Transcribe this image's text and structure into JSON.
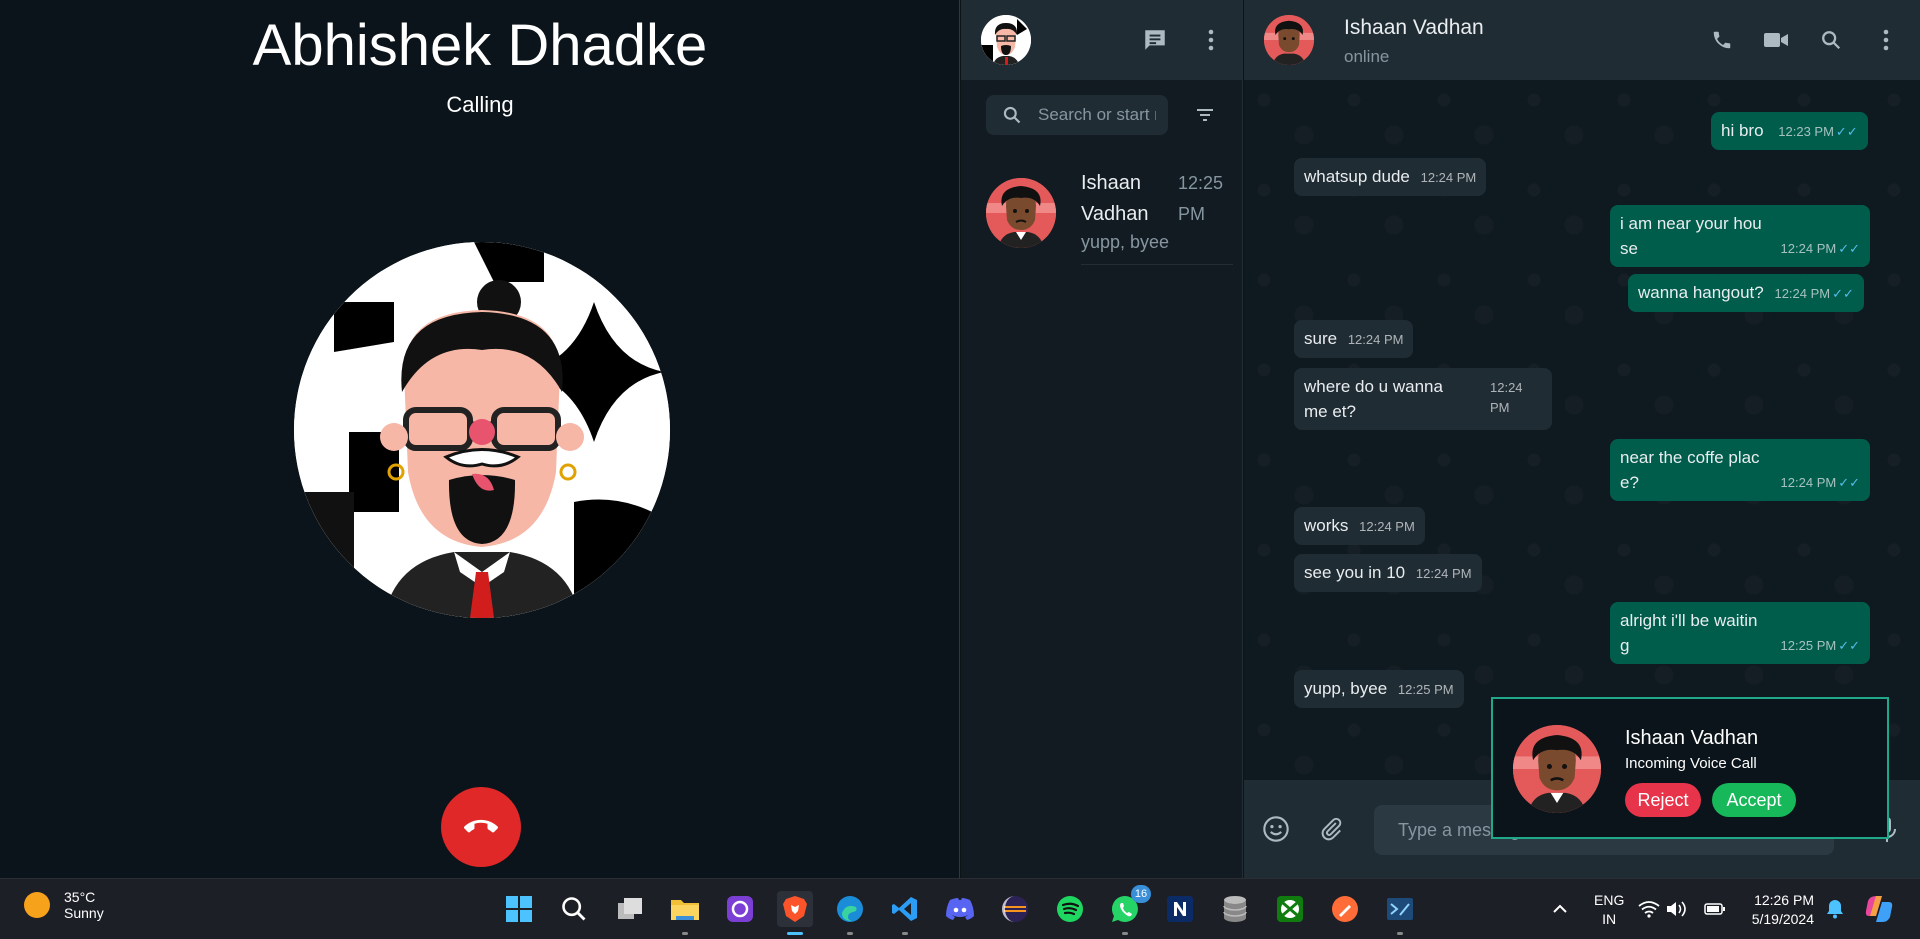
{
  "call": {
    "caller_name": "Abhishek Dhadke",
    "status": "Calling"
  },
  "chat_list": {
    "search_placeholder": "Search or start new chat",
    "items": [
      {
        "name": "Ishaan Vadhan",
        "time": "12:25 PM",
        "preview": "yupp, byee"
      }
    ]
  },
  "conversation": {
    "contact_name": "Ishaan Vadhan",
    "contact_status": "online",
    "messages": [
      {
        "dir": "out",
        "text": "hi bro",
        "time": "12:23 PM"
      },
      {
        "dir": "in",
        "text": "whatsup dude",
        "time": "12:24 PM"
      },
      {
        "dir": "out",
        "text": "i am near your hou se",
        "time": "12:24 PM"
      },
      {
        "dir": "out",
        "text": "wanna hangout?",
        "time": "12:24 PM"
      },
      {
        "dir": "in",
        "text": "sure",
        "time": "12:24 PM"
      },
      {
        "dir": "in",
        "text": "where do u wanna me et?",
        "time": "12:24 PM"
      },
      {
        "dir": "out",
        "text": "near the coffe plac e?",
        "time": "12:24 PM"
      },
      {
        "dir": "in",
        "text": "works",
        "time": "12:24 PM"
      },
      {
        "dir": "in",
        "text": "see you in 10",
        "time": "12:24 PM"
      },
      {
        "dir": "out",
        "text": "alright i'll be waitin g",
        "time": "12:25 PM"
      },
      {
        "dir": "in",
        "text": "yupp, byee",
        "time": "12:25 PM"
      }
    ],
    "input_placeholder": "Type a message"
  },
  "incoming_call": {
    "name": "Ishaan Vadhan",
    "subtitle": "Incoming Voice Call",
    "reject_label": "Reject",
    "accept_label": "Accept"
  },
  "taskbar": {
    "weather_temp": "35°C",
    "weather_cond": "Sunny",
    "lang_line1": "ENG",
    "lang_line2": "IN",
    "time": "12:26 PM",
    "date": "5/19/2024",
    "whatsapp_badge": "16"
  },
  "colors": {
    "outgoing_bubble": "#005c4b",
    "incoming_bubble": "#202c33",
    "end_call": "#e02828",
    "reject": "#e8344a",
    "accept": "#16b85a",
    "read_ticks": "#53bdeb"
  }
}
